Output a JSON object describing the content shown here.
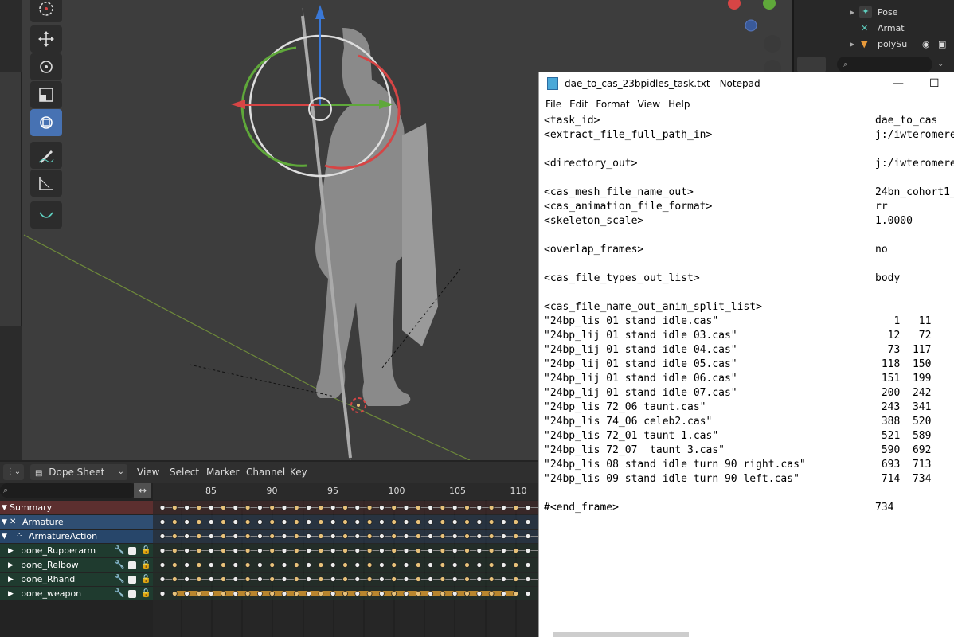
{
  "notepad": {
    "title": "dae_to_cas_23bpidles_task.txt - Notepad",
    "menu": [
      "File",
      "Edit",
      "Format",
      "View",
      "Help"
    ],
    "lines": [
      {
        "key": "<task_id>",
        "value": "dae_to_cas"
      },
      {
        "key": "<extract_file_full_path_in>",
        "value": "j:/iwteromere"
      },
      {
        "key": "",
        "value": ""
      },
      {
        "key": "<directory_out>",
        "value": "j:/iwteromere"
      },
      {
        "key": "",
        "value": ""
      },
      {
        "key": "<cas_mesh_file_name_out>",
        "value": "24bn_cohort1_"
      },
      {
        "key": "<cas_animation_file_format>",
        "value": "rr"
      },
      {
        "key": "<skeleton_scale>",
        "value": "1.0000"
      },
      {
        "key": "",
        "value": ""
      },
      {
        "key": "<overlap_frames>",
        "value": "no"
      },
      {
        "key": "",
        "value": ""
      },
      {
        "key": "<cas_file_types_out_list>",
        "value": "body"
      },
      {
        "key": "",
        "value": ""
      },
      {
        "key": "<cas_file_name_out_anim_split_list>",
        "value": ""
      },
      {
        "key": "\"24bp_lis 01 stand idle.cas\"",
        "value": "   1   11"
      },
      {
        "key": "\"24bp_lij 01 stand idle 03.cas\"",
        "value": "  12   72"
      },
      {
        "key": "\"24bp_lij 01 stand idle 04.cas\"",
        "value": "  73  117"
      },
      {
        "key": "\"24bp_lij 01 stand idle 05.cas\"",
        "value": " 118  150"
      },
      {
        "key": "\"24bp_lij 01 stand idle 06.cas\"",
        "value": " 151  199"
      },
      {
        "key": "\"24bp_lij 01 stand idle 07.cas\"",
        "value": " 200  242"
      },
      {
        "key": "\"24bp_lis 72_06 taunt.cas\"",
        "value": " 243  341"
      },
      {
        "key": "\"24bp_lis 74_06 celeb2.cas\"",
        "value": " 388  520"
      },
      {
        "key": "\"24bp_lis 72_01 taunt 1.cas\"",
        "value": " 521  589"
      },
      {
        "key": "\"24bp_lis 72_07  taunt 3.cas\"",
        "value": " 590  692"
      },
      {
        "key": "\"24bp_lis 08 stand idle turn 90 right.cas\"",
        "value": " 693  713"
      },
      {
        "key": "\"24bp_lis 09 stand idle turn 90 left.cas\"",
        "value": " 714  734"
      },
      {
        "key": "",
        "value": ""
      },
      {
        "key": "#<end_frame>",
        "value": "734"
      }
    ]
  },
  "outliner": {
    "items": [
      {
        "label": "Pose"
      },
      {
        "label": "Armat"
      },
      {
        "label": "polySu"
      }
    ]
  },
  "dopesheet": {
    "mode_label": "Dope Sheet",
    "menu": [
      "View",
      "Select",
      "Marker",
      "Channel",
      "Key"
    ],
    "ruler": [
      "85",
      "90",
      "95",
      "100",
      "105",
      "110"
    ],
    "channels": [
      {
        "label": "Summary",
        "kind": "summary"
      },
      {
        "label": "Armature",
        "kind": "object"
      },
      {
        "label": "ArmatureAction",
        "kind": "action"
      },
      {
        "label": "bone_Rupperarm",
        "kind": "bone"
      },
      {
        "label": "bone_Relbow",
        "kind": "bone"
      },
      {
        "label": "bone_Rhand",
        "kind": "bone"
      },
      {
        "label": "bone_weapon",
        "kind": "bone"
      }
    ]
  },
  "colors": {
    "summary_bg": "#5c2f2f",
    "object_bg": "#2f4e72",
    "action_bg": "#27466a",
    "bone_bg": "#1f3b2f",
    "key": "#e8c27a",
    "accent": "#4772b3"
  }
}
